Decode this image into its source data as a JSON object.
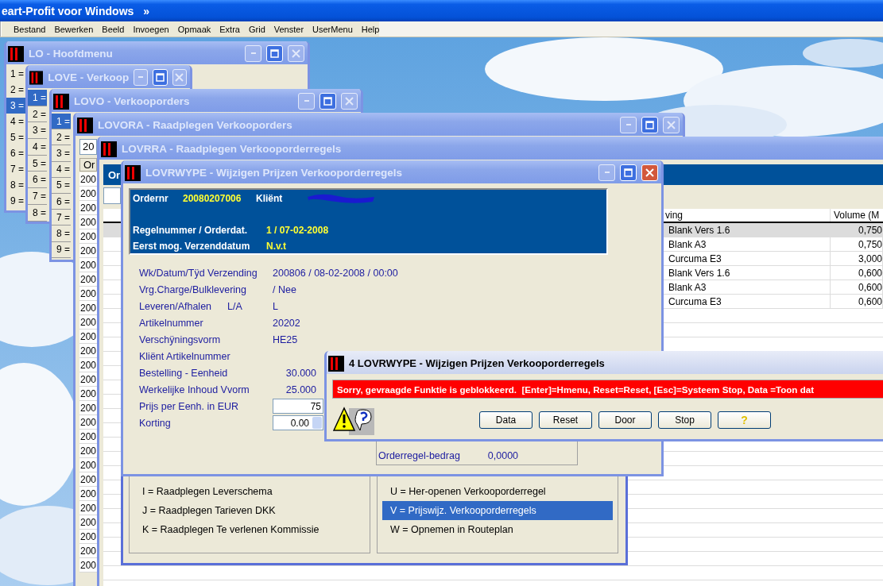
{
  "app": {
    "title": "eart-Profit voor Windows",
    "chevron": "»"
  },
  "menu": [
    "Bestand",
    "Bewerken",
    "Beeld",
    "Invoegen",
    "Opmaak",
    "Extra",
    "Grid",
    "Venster",
    "UserMenu",
    "Help"
  ],
  "hoofdmenu": {
    "title": "LO - Hoofdmenu",
    "active": false,
    "items": [
      {
        "label": "1 =",
        "selected": false
      },
      {
        "label": "2 =",
        "selected": false
      },
      {
        "label": "3 =",
        "selected": true
      },
      {
        "label": "4 =",
        "selected": false
      },
      {
        "label": "5 =",
        "selected": false
      },
      {
        "label": "6 =",
        "selected": false
      },
      {
        "label": "7 =",
        "selected": false
      },
      {
        "label": "8 =",
        "selected": false
      },
      {
        "label": "9 =",
        "selected": false
      }
    ]
  },
  "verkoop": {
    "title": "LOVE - Verkoop",
    "active": false,
    "items": [
      {
        "label": "1 =",
        "selected": true
      },
      {
        "label": "2 =",
        "selected": false
      },
      {
        "label": "3 =",
        "selected": false
      },
      {
        "label": "4 =",
        "selected": false
      },
      {
        "label": "5 =",
        "selected": false
      },
      {
        "label": "6 =",
        "selected": false
      },
      {
        "label": "7 =",
        "selected": false
      },
      {
        "label": "8 =",
        "selected": false
      }
    ]
  },
  "verkooporders": {
    "title": "LOVO - Verkooporders",
    "active": false,
    "items": [
      {
        "label": "1 =",
        "selected": true
      },
      {
        "label": "2 =",
        "selected": false
      },
      {
        "label": "3 =",
        "selected": false
      },
      {
        "label": "4 =",
        "selected": false
      },
      {
        "label": "5 =",
        "selected": false
      },
      {
        "label": "6 =",
        "selected": false
      },
      {
        "label": "7 =",
        "selected": false
      },
      {
        "label": "8 =",
        "selected": false
      },
      {
        "label": "9 =",
        "selected": false
      }
    ]
  },
  "raadplegen_orders": {
    "title": "LOVORA - Raadplegen Verkooporders",
    "active": false,
    "search_value": "20",
    "column_1": "Or",
    "rows": [
      "200",
      "200",
      "200",
      "200",
      "200",
      "200",
      "200",
      "200",
      "200",
      "200",
      "200",
      "200",
      "200",
      "200",
      "200",
      "200",
      "200",
      "200",
      "200",
      "200",
      "200",
      "200",
      "200",
      "200",
      "200",
      "200",
      "200",
      "200"
    ]
  },
  "raadplegen_regels": {
    "title": "LOVRRA - Raadplegen Verkooporderregels",
    "band": "Or",
    "columns": [
      "ving",
      "Volume (M"
    ],
    "rows": [
      {
        "cells": [
          "Blank Vers 1.6",
          "0,750"
        ],
        "selected": true
      },
      {
        "cells": [
          "Blank A3",
          "0,750"
        ],
        "selected": false
      },
      {
        "cells": [
          "Curcuma E3",
          "3,000"
        ],
        "selected": false
      },
      {
        "cells": [
          "Blank Vers 1.6",
          "0,600"
        ],
        "selected": false
      },
      {
        "cells": [
          "Blank A3",
          "0,600"
        ],
        "selected": false
      },
      {
        "cells": [
          "Curcuma E3",
          "0,600"
        ],
        "selected": false
      }
    ]
  },
  "wijzigen": {
    "title": "LOVRWYPE - Wijzigen Prijzen Verkooporderregels",
    "active": true,
    "header": {
      "ordernr_label": "Ordernr",
      "ordernr": "20080207006",
      "client_label": "Kliënt",
      "regel_label": "Regelnummer / Orderdat.",
      "regel": "1 / 07-02-2008",
      "verzend_label": "Eerst mog. Verzenddatum",
      "verzend": "N.v.t"
    },
    "fields": [
      {
        "kind": "text",
        "label": "Wk/Datum/Tÿd Verzending",
        "value": "200806 / 08-02-2008 / 00:00"
      },
      {
        "kind": "text",
        "label": "Vrg.Charge/Bulklevering",
        "value": "/ Nee"
      },
      {
        "kind": "code",
        "label": "Leveren/Afhalen",
        "code": "L/A",
        "value": "L"
      },
      {
        "kind": "text",
        "label": "Artikelnummer",
        "value": "20202"
      },
      {
        "kind": "text",
        "label": "Verschÿningsvorm",
        "value": "HE25"
      },
      {
        "kind": "empty",
        "label": "Kliënt Artikelnummer"
      },
      {
        "kind": "number",
        "label": "Bestelling - Eenheid",
        "value": "30.000"
      },
      {
        "kind": "number",
        "label": "Werkelijke Inhoud Vvorm",
        "value": "25.000"
      },
      {
        "kind": "input",
        "label": "Prijs per Eenh. in EUR",
        "value": "75"
      },
      {
        "kind": "spin",
        "label": "Korting",
        "value": "0.00"
      }
    ],
    "total": {
      "label": "Orderregel-bedrag",
      "value": "0,0000"
    }
  },
  "options": {
    "left": [
      {
        "label": "I = Raadplegen Leverschema",
        "selected": false
      },
      {
        "label": "J = Raadplegen Tarieven DKK",
        "selected": false
      },
      {
        "label": "K = Raadplegen Te verlenen Kommissie",
        "selected": false
      }
    ],
    "right": [
      {
        "label": "U = Her-openen Verkooporderregel",
        "selected": false
      },
      {
        "label": "V = Prijswijz. Verkooporderregels",
        "selected": true
      },
      {
        "label": "W = Opnemen in Routeplan",
        "selected": false
      }
    ]
  },
  "dialog": {
    "title": "4 LOVRWYPE - Wijzigen Prijzen Verkooporderregels",
    "message": "Sorry, gevraagde Funktie is geblokkeerd.  [Enter]=Hmenu, Reset=Reset, [Esc]=Systeem Stop, Data =Toon dat",
    "buttons": [
      "Data",
      "Reset",
      "Door",
      "Stop",
      "?"
    ]
  }
}
